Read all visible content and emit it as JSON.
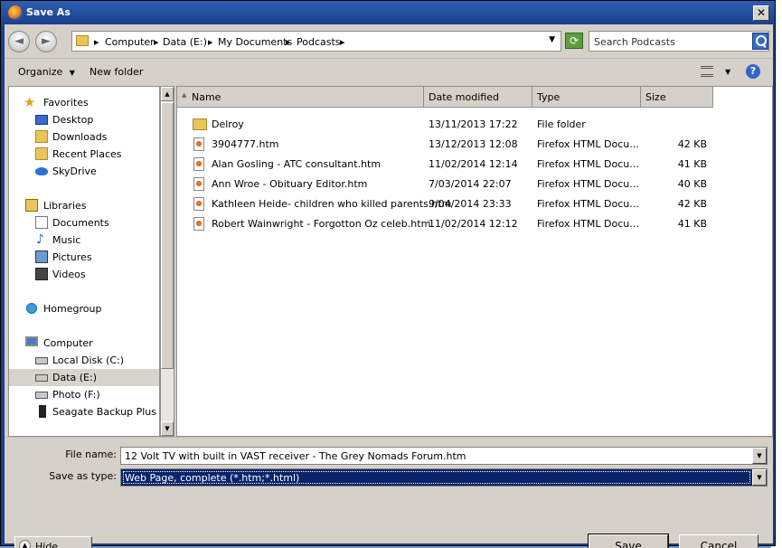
{
  "window": {
    "title": "Save As",
    "close_glyph": "✕"
  },
  "address": {
    "back_glyph": "◄",
    "forward_glyph": "►",
    "crumbs": [
      "Computer",
      "Data (E:)",
      "My Documents",
      "Podcasts"
    ],
    "separator": "▸",
    "dropdown_glyph": "▼",
    "refresh_glyph": "⟳"
  },
  "search": {
    "placeholder": "Search Podcasts"
  },
  "toolbar": {
    "organize_label": "Organize",
    "organize_glyph": "▼",
    "new_folder_label": "New folder",
    "view_glyph": "▼",
    "help_glyph": "?"
  },
  "sidebar": {
    "items": [
      {
        "label": "Favorites",
        "icon": "star-icon",
        "glyph": "★"
      },
      {
        "label": "Desktop",
        "icon": "desktop-icon"
      },
      {
        "label": "Downloads",
        "icon": "downloads-icon"
      },
      {
        "label": "Recent Places",
        "icon": "recent-places-icon"
      },
      {
        "label": "SkyDrive",
        "icon": "skydrive-icon"
      },
      {
        "label": "Libraries",
        "icon": "libraries-icon"
      },
      {
        "label": "Documents",
        "icon": "documents-icon"
      },
      {
        "label": "Music",
        "icon": "music-icon",
        "glyph": "♪"
      },
      {
        "label": "Pictures",
        "icon": "pictures-icon"
      },
      {
        "label": "Videos",
        "icon": "videos-icon"
      },
      {
        "label": "Homegroup",
        "icon": "homegroup-icon"
      },
      {
        "label": "Computer",
        "icon": "computer-icon"
      },
      {
        "label": "Local Disk (C:)",
        "icon": "drive-icon"
      },
      {
        "label": "Data (E:)",
        "icon": "drive-icon",
        "selected": true
      },
      {
        "label": "Photo (F:)",
        "icon": "drive-icon"
      },
      {
        "label": "Seagate Backup Plus Drive",
        "icon": "external-drive-icon"
      }
    ],
    "scroll_up_glyph": "▲",
    "scroll_down_glyph": "▼"
  },
  "columns": {
    "name": "Name",
    "sort_glyph": "▲",
    "date": "Date modified",
    "type": "Type",
    "size": "Size"
  },
  "files": [
    {
      "name": "Delroy",
      "date": "13/11/2013 17:22",
      "type": "File folder",
      "size": "",
      "icon": "folder-icon"
    },
    {
      "name": "3904777.htm",
      "date": "13/12/2013 12:08",
      "type": "Firefox HTML Docu...",
      "size": "42 KB",
      "icon": "firefox-file-icon"
    },
    {
      "name": "Alan Gosling - ATC consultant.htm",
      "date": "11/02/2014 12:14",
      "type": "Firefox HTML Docu...",
      "size": "41 KB",
      "icon": "firefox-file-icon"
    },
    {
      "name": "Ann Wroe - Obituary Editor.htm",
      "date": "7/03/2014 22:07",
      "type": "Firefox HTML Docu...",
      "size": "40 KB",
      "icon": "firefox-file-icon"
    },
    {
      "name": "Kathleen Heide- children who killed parents.htm",
      "date": "9/04/2014 23:33",
      "type": "Firefox HTML Docu...",
      "size": "42 KB",
      "icon": "firefox-file-icon"
    },
    {
      "name": "Robert Wainwright - Forgotton Oz celeb.htm",
      "date": "11/02/2014 12:12",
      "type": "Firefox HTML Docu...",
      "size": "41 KB",
      "icon": "firefox-file-icon"
    }
  ],
  "bottom": {
    "file_name_label": "File name:",
    "file_name_value": "12 Volt TV with built in VAST receiver - The Grey Nomads Forum.htm",
    "save_type_label": "Save as type:",
    "save_type_value": "Web Page, complete (*.htm;*.html)",
    "dropdown_glyph": "▼",
    "hide_folders_label": "Hide Folders",
    "hide_glyph": "▲",
    "save_label": "Save",
    "cancel_label": "Cancel"
  },
  "colors": {
    "title_bar": "#1d3f89",
    "selection": "#0a246a",
    "dialog_face": "#d5d0c8"
  }
}
